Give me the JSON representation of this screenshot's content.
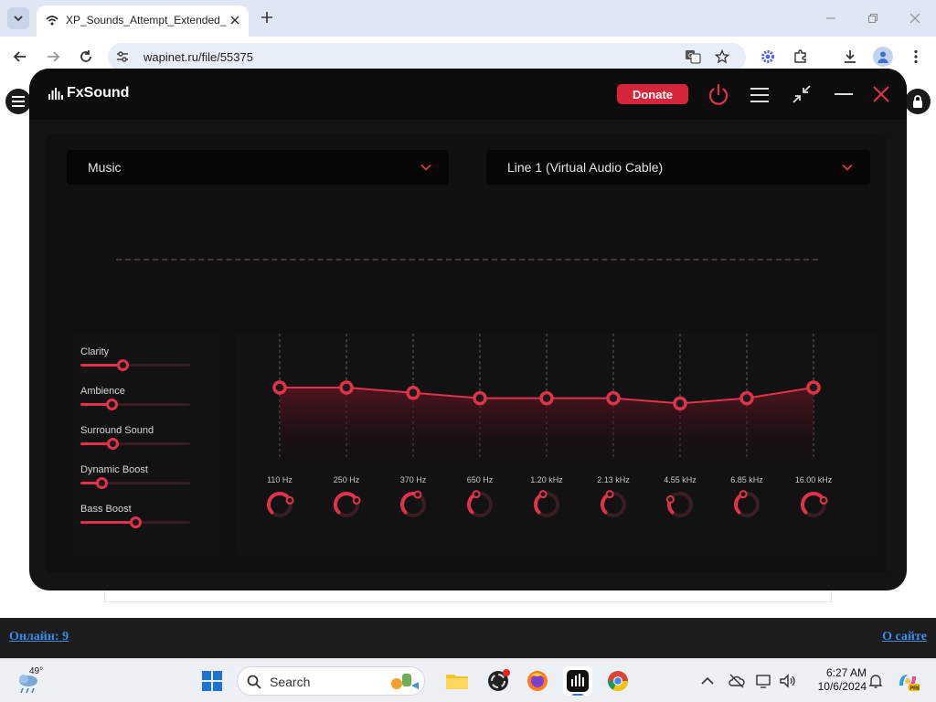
{
  "browser": {
    "tab_title": "XP_Sounds_Attempt_Extended_",
    "url": "wapinet.ru/file/55375"
  },
  "app": {
    "name": "FxSound",
    "donate_label": "Donate",
    "preset": "Music",
    "output_device": "Line 1 (Virtual Audio Cable)",
    "accent_color": "#e0334a",
    "effects": [
      {
        "label": "Clarity",
        "level": 0.38
      },
      {
        "label": "Ambience",
        "level": 0.28
      },
      {
        "label": "Surround Sound",
        "level": 0.29
      },
      {
        "label": "Dynamic Boost",
        "level": 0.19
      },
      {
        "label": "Bass Boost",
        "level": 0.5
      }
    ],
    "eq_bands": [
      {
        "label": "110 Hz",
        "gain": 0.0
      },
      {
        "label": "250 Hz",
        "gain": 0.0
      },
      {
        "label": "370 Hz",
        "gain": -0.4
      },
      {
        "label": "650 Hz",
        "gain": -0.8
      },
      {
        "label": "1.20 kHz",
        "gain": -0.8
      },
      {
        "label": "2.13 kHz",
        "gain": -0.8
      },
      {
        "label": "4.55 kHz",
        "gain": -1.2
      },
      {
        "label": "6.85 kHz",
        "gain": -0.8
      },
      {
        "label": "16.00 kHz",
        "gain": 0.0
      }
    ]
  },
  "page": {
    "online_link": "Онлайн: 9",
    "about_link": "О сайте"
  },
  "taskbar": {
    "temperature": "49°",
    "search_label": "Search",
    "time": "6:27 AM",
    "date": "10/6/2024"
  }
}
